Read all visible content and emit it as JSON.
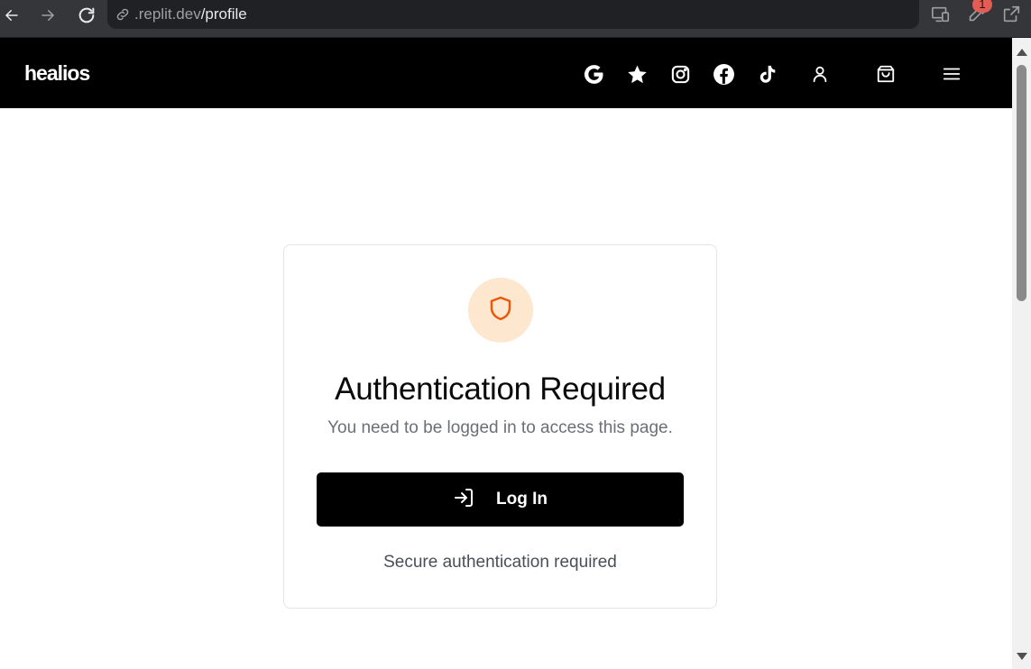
{
  "browser": {
    "url_host": ".replit.dev",
    "url_path": "/profile",
    "extensions_badge": "1",
    "icons": [
      "back-arrow-icon",
      "forward-arrow-icon",
      "reload-icon",
      "link-icon",
      "devices-icon",
      "extensions-icon",
      "open-external-icon"
    ]
  },
  "header": {
    "brand": "healios",
    "icons": [
      "google-icon",
      "star-icon",
      "instagram-icon",
      "facebook-icon",
      "tiktok-icon",
      "user-icon",
      "shopping-bag-icon",
      "menu-icon"
    ]
  },
  "auth_card": {
    "icon": "shield-icon",
    "title": "Authentication Required",
    "subtitle": "You need to be logged in to access this page.",
    "login_label": "Log In",
    "login_icon": "log-in-icon",
    "footer": "Secure authentication required"
  },
  "colors": {
    "header_bg": "#000000",
    "shield_bg": "#fde7cf",
    "shield_stroke": "#ea580c",
    "button_bg": "#000000"
  }
}
